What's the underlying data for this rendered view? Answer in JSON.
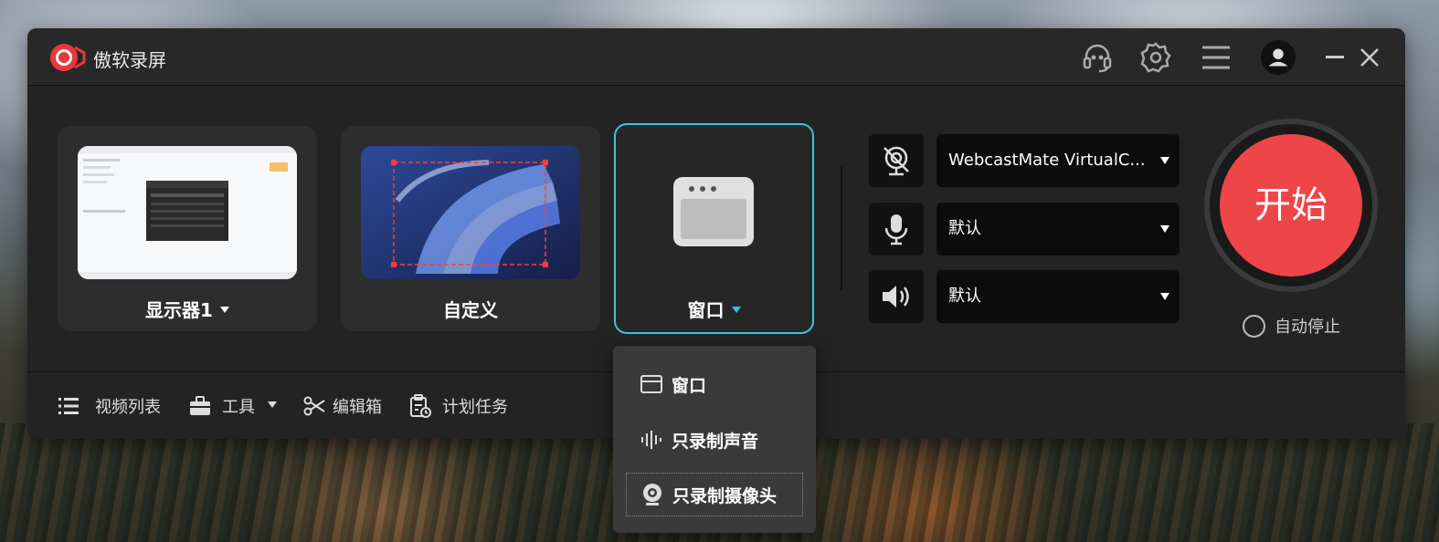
{
  "app": {
    "title": "傲软录屏",
    "accent_color": "#3cc4e0",
    "start_color": "#ee4548"
  },
  "titlebar": {
    "icons": [
      "headset-icon",
      "gear-icon",
      "menu-icon",
      "avatar-icon",
      "minimize-icon",
      "close-icon"
    ]
  },
  "modes": [
    {
      "label": "显示器1",
      "icon": "monitor-thumbnail",
      "has_dropdown": true,
      "active": false
    },
    {
      "label": "自定义",
      "icon": "custom-region-thumbnail",
      "has_dropdown": false,
      "active": false
    },
    {
      "label": "窗口",
      "icon": "window-icon",
      "has_dropdown": true,
      "active": true
    }
  ],
  "devices": {
    "camera": {
      "icon": "camera-off-icon",
      "value": "WebcastMate VirtualC..."
    },
    "microphone": {
      "icon": "microphone-icon",
      "value": "默认"
    },
    "speaker": {
      "icon": "speaker-icon",
      "value": "默认"
    }
  },
  "start": {
    "label": "开始",
    "auto_stop_label": "自动停止",
    "auto_stop_checked": false
  },
  "bottombar": {
    "video_list": "视频列表",
    "tools": "工具",
    "editor": "编辑箱",
    "schedule": "计划任务"
  },
  "dropdown": {
    "items": [
      {
        "label": "窗口",
        "icon": "window-icon"
      },
      {
        "label": "只录制声音",
        "icon": "audio-wave-icon"
      },
      {
        "label": "只录制摄像头",
        "icon": "webcam-icon",
        "focused": true
      }
    ]
  }
}
